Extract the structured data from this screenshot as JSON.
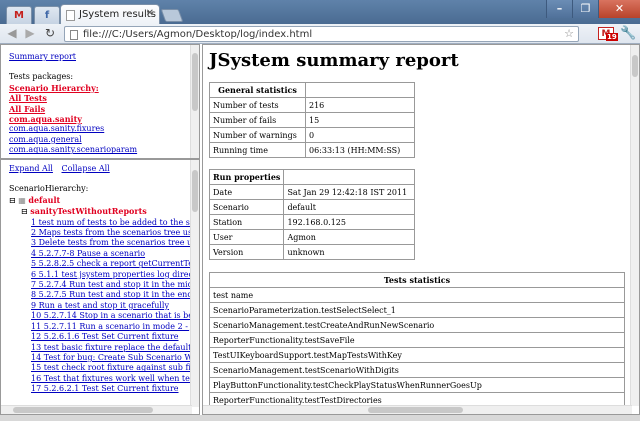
{
  "browser": {
    "active_tab_title": "JSystem results",
    "tab_close": "✕",
    "url": "file:///C:/Users/Agmon/Desktop/log/index.html",
    "gmail_badge": "19",
    "win_controls": {
      "minimize": "–",
      "maximize": "❐",
      "close": "✕"
    }
  },
  "top_frame": {
    "summary_link": "Summary report",
    "packages_label": "Tests packages:",
    "scenario_hierarchy": "Scenario Hierarchy:",
    "all_tests": "All Tests",
    "all_fails": "All Fails",
    "packages": [
      "com.aqua.sanity",
      "com.aqua.sanity.fixures",
      "com.aqua.general",
      "com.aqua.sanity.scenarioparam"
    ]
  },
  "bottom_frame": {
    "expand_all": "Expand All",
    "collapse_all": "Collapse All",
    "hierarchy_label": "ScenarioHierarchy:",
    "root_node": "default",
    "child_node": "sanityTestWithoutReports",
    "tests": [
      "1 test num of tests to be added to the scenario tree",
      "2 Maps tests from the scenarios tree using the \"Sp",
      "3 Delete tests from the scenarios tree using the \"D",
      "4 5.2.7.7-8 Pause a scenario",
      "5 5.2.8.2.5 check a report getCurrentTestFolder",
      "6 5.1.1 test jsystem properties log directory",
      "7 5.2.7.4 Run test and stop it in the middle",
      "8 5.2.7.5 Run test and stop it in the end of the sce",
      "9 Run a test and stop it gracefully",
      "10 5.2.7.14 Stop in a scenario that is been repeat",
      "11 5.2.7.11 Run a scenario in mode 2 - JVM per",
      "12 5.2.6.1.6 Test Set Current fixture",
      "13 test basic fixture replace the default fixture for",
      "14 Test for bug: Create Sub Scenario With Fixture",
      "15 test check root fixture against sub fixture",
      "16 Test that fixtures work well when test is added",
      "17 5.2.6.2.1 Test Set Current fixture"
    ]
  },
  "main": {
    "title": "JSystem summary report",
    "general": {
      "header": "General statistics",
      "rows": [
        {
          "label": "Number of tests",
          "value": "216"
        },
        {
          "label": "Number of fails",
          "value": "15"
        },
        {
          "label": "Number of warnings",
          "value": "0"
        },
        {
          "label": "Running time",
          "value": "06:33:13 (HH:MM:SS)"
        }
      ]
    },
    "run": {
      "header": "Run properties",
      "rows": [
        {
          "label": "Date",
          "value": "Sat Jan 29 12:42:18 IST 2011"
        },
        {
          "label": "Scenario",
          "value": "default"
        },
        {
          "label": "Station",
          "value": "192.168.0.125"
        },
        {
          "label": "User",
          "value": "Agmon"
        },
        {
          "label": "Version",
          "value": "unknown"
        }
      ]
    },
    "tests_stats": {
      "header": "Tests statistics",
      "col_header": "test name",
      "rows": [
        "ScenarioParameterization.testSelectSelect_1",
        "ScenarioManagement.testCreateAndRunNewScenario",
        "ReporterFunctionality.testSaveFile",
        "TestUIKeyboardSupport.testMapTestsWithKey",
        "ScenarioManagement.testScenarioWithDigits",
        "PlayButtonFunctionality.testCheckPlayStatusWhenRunnerGoesUp",
        "ReporterFunctionality.testTestDirectories"
      ]
    }
  }
}
